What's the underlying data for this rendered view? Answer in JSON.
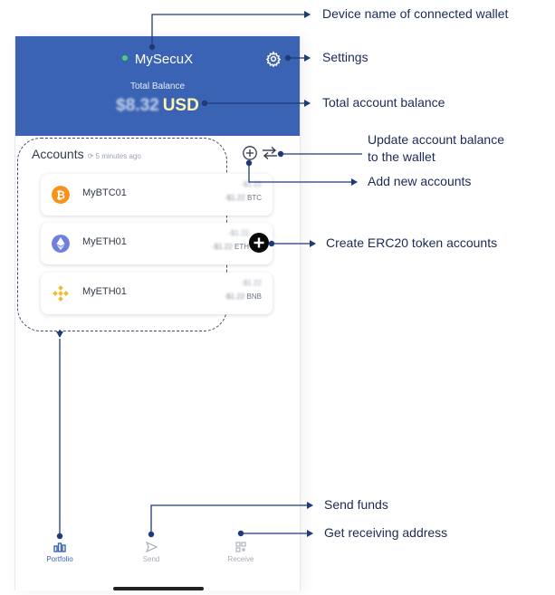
{
  "app": {
    "device_name": "MySecuX",
    "balance_label": "Total Balance",
    "balance_value": "$8.32",
    "balance_currency": "USD"
  },
  "accounts": {
    "title": "Accounts",
    "updated": "5 minutes ago",
    "items": [
      {
        "name": "MyBTC01",
        "value1": "-$1.22",
        "value2": "-$1.22",
        "symbol": "BTC",
        "icon": "bitcoin-icon",
        "color": "#f7931a"
      },
      {
        "name": "MyETH01",
        "value1": "-$1.22",
        "value2": "-$1.22",
        "symbol": "ETH",
        "icon": "ethereum-icon",
        "color": "#6f7fe0"
      },
      {
        "name": "MyETH01",
        "value1": "-$1.22",
        "value2": "-$1.22",
        "symbol": "BNB",
        "icon": "binance-icon",
        "color": "#f3ba2f"
      }
    ]
  },
  "tabs": [
    {
      "label": "Portfolio",
      "icon": "portfolio-icon"
    },
    {
      "label": "Send",
      "icon": "send-icon"
    },
    {
      "label": "Receive",
      "icon": "receive-icon"
    }
  ],
  "annotations": {
    "device_name": "Device name of connected wallet",
    "settings": "Settings",
    "total_balance": "Total account balance",
    "update_line1": "Update account balance",
    "update_line2": "to the wallet",
    "add_accounts": "Add new accounts",
    "erc20": "Create ERC20 token accounts",
    "send_funds": "Send funds",
    "receive": "Get receiving address"
  },
  "colors": {
    "header": "#3b63b3",
    "annotation_text": "#1b2a56",
    "annotation_line": "#1f3a7a"
  }
}
